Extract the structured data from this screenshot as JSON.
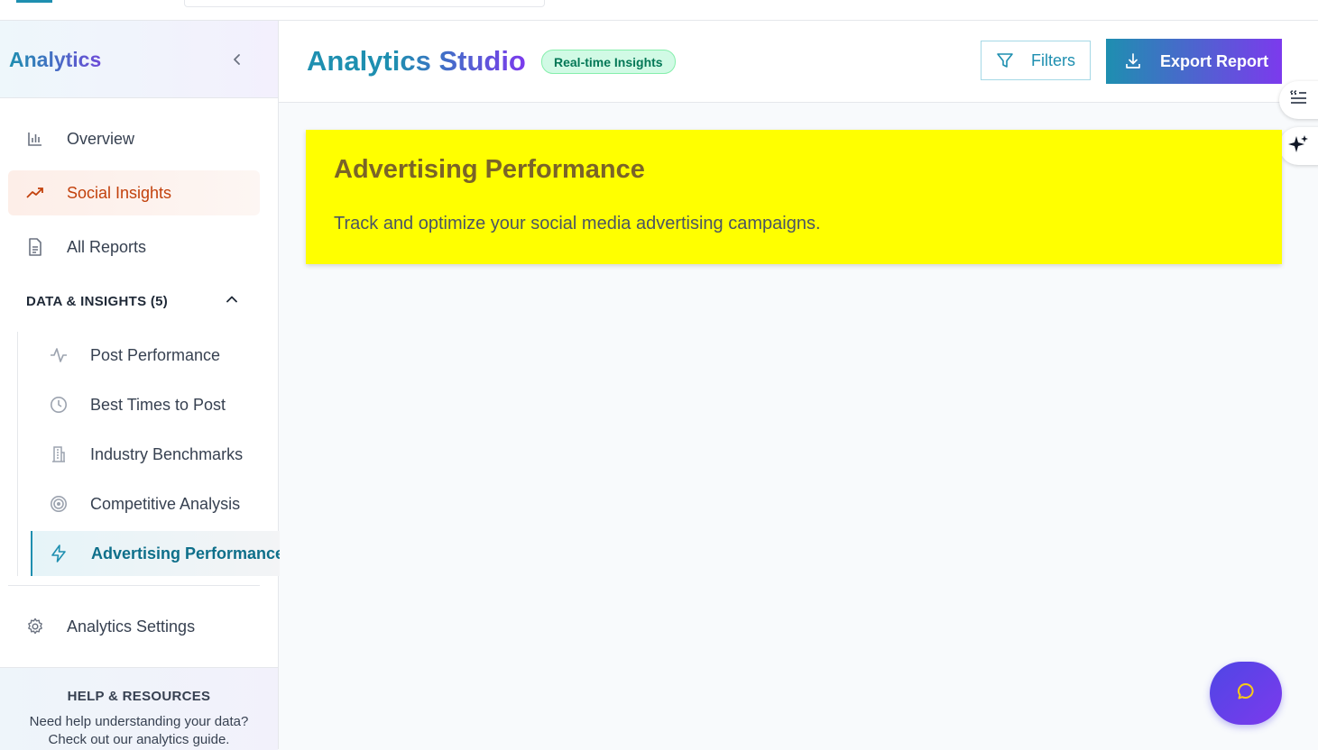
{
  "sidebar": {
    "title": "Analytics",
    "collapse_icon": "chevron-left-icon",
    "items": [
      {
        "label": "Overview",
        "icon": "bar-chart-icon"
      },
      {
        "label": "Social Insights",
        "icon": "trending-up-icon",
        "active": true
      },
      {
        "label": "All Reports",
        "icon": "document-icon"
      }
    ],
    "section": {
      "label": "DATA & INSIGHTS (5)",
      "icon": "chevron-up-icon",
      "expanded": true
    },
    "sub_items": [
      {
        "label": "Post Performance",
        "icon": "activity-icon"
      },
      {
        "label": "Best Times to Post",
        "icon": "clock-icon"
      },
      {
        "label": "Industry Benchmarks",
        "icon": "building-icon"
      },
      {
        "label": "Competitive Analysis",
        "icon": "target-icon"
      },
      {
        "label": "Advertising Performance",
        "icon": "lightning-icon",
        "active": true
      }
    ],
    "settings": {
      "label": "Analytics Settings",
      "icon": "gear-icon"
    },
    "help": {
      "title": "HELP & RESOURCES",
      "line1": "Need help understanding your data?",
      "line2": "Check out our analytics guide."
    }
  },
  "header": {
    "title": "Analytics Studio",
    "badge": "Real-time Insights",
    "filters_label": "Filters",
    "export_label": "Export Report"
  },
  "banner": {
    "title": "Advertising Performance",
    "description": "Track and optimize your social media advertising campaigns."
  },
  "colors": {
    "accent": "#1e8fb0",
    "accent2": "#7c3aed",
    "active_nav": "#c2410c",
    "banner_bg": "#ffff00"
  }
}
